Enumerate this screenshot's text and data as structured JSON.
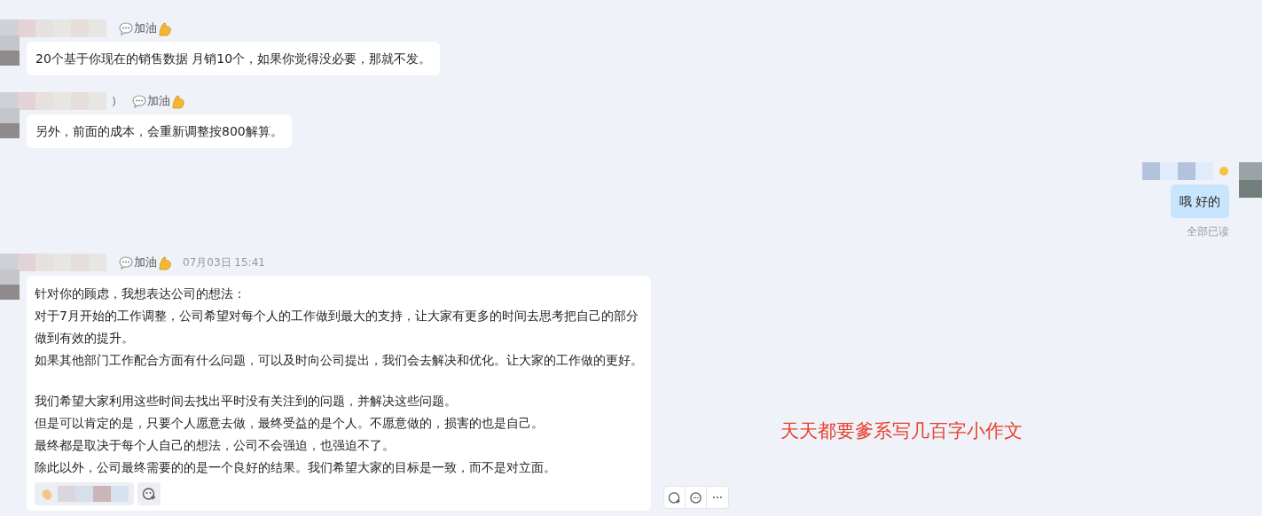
{
  "messages": [
    {
      "kind": "incoming",
      "status": "加油",
      "paragraphs": [
        [
          "20个基于你现在的销售数据 月销10个，如果你觉得没必要，那就不发。"
        ]
      ]
    },
    {
      "kind": "incoming",
      "status": "加油",
      "name_suffix": ")",
      "paragraphs": [
        [
          "另外，前面的成本，会重新调整按800解算。"
        ]
      ]
    },
    {
      "kind": "outgoing",
      "paragraphs": [
        [
          "哦  好的"
        ]
      ],
      "receipt": "全部已读"
    },
    {
      "kind": "incoming",
      "status": "加油",
      "timestamp": "07月03日 15:41",
      "paragraphs": [
        [
          "针对你的顾虑，我想表达公司的想法：",
          "对于7月开始的工作调整，公司希望对每个人的工作做到最大的支持，让大家有更多的时间去思考把自己的部分",
          "做到有效的提升。",
          "如果其他部门工作配合方面有什么问题，可以及时向公司提出，我们会去解决和优化。让大家的工作做的更好。"
        ],
        [
          "我们希望大家利用这些时间去找出平时没有关注到的问题，并解决这些问题。",
          "但是可以肯定的是，只要个人愿意去做，最终受益的是个人。不愿意做的，损害的也是自己。",
          "最终都是取决于每个人自己的想法，公司不会强迫，也强迫不了。",
          "除此以外，公司最终需要的的是一个良好的结果。我们希望大家的目标是一致，而不是对立面。"
        ]
      ],
      "reactions": [
        {
          "kind": "clap"
        }
      ],
      "hover_actions": true
    }
  ],
  "annotation": "天天都要爹系写几百字小作文"
}
